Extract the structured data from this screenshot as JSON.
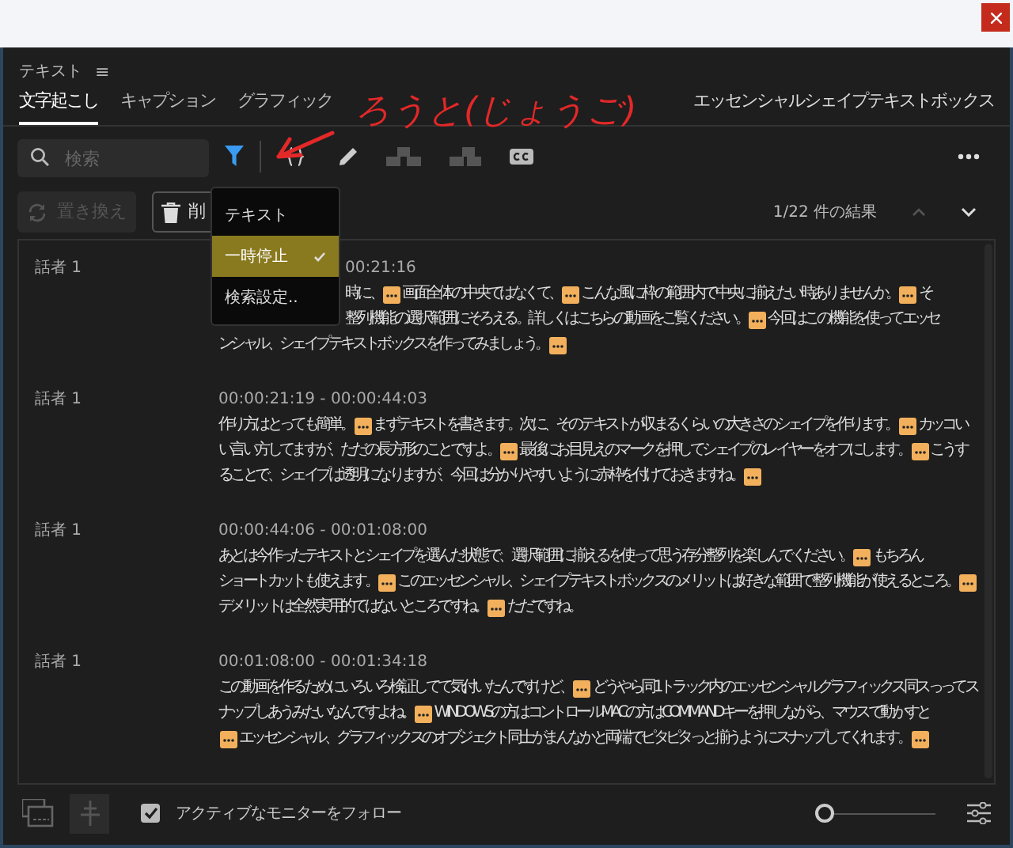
{
  "panel": {
    "title": "テキスト",
    "menu_icon": "≡"
  },
  "tabs": [
    {
      "label": "文字起こし",
      "selected": true
    },
    {
      "label": "キャプション",
      "selected": false
    },
    {
      "label": "グラフィック",
      "selected": false
    }
  ],
  "panel_context": "エッセンシャルシェイプテキストボックス",
  "annotation": {
    "text": "ろうと(じょうご)"
  },
  "search": {
    "placeholder": "検索"
  },
  "filter": {
    "on": true
  },
  "actions": [
    {
      "label": "置き換え",
      "disabled": true,
      "kind": "replace"
    },
    {
      "label": "削",
      "disabled": false,
      "kind": "delete"
    }
  ],
  "results": "1/22 件の結果",
  "filter_menu": [
    {
      "label": "テキスト",
      "selected": false
    },
    {
      "label": "一時停止",
      "selected": true
    },
    {
      "label": "検索設定..",
      "selected": false
    }
  ],
  "segments": [
    {
      "speaker": "話者 1",
      "timecode": "00:21:16",
      "kind": "partial",
      "lines": [
        [
          {
            "kind": "text",
            "text": "時に、"
          },
          {
            "kind": "marker"
          },
          {
            "kind": "text",
            "text": "画面全体の中央ではなくて、"
          },
          {
            "kind": "marker"
          },
          {
            "kind": "text",
            "text": "こんな風に枠の範囲内で中央に揃えたい時ありませんか。"
          },
          {
            "kind": "marker"
          },
          {
            "kind": "text",
            "text": "そ"
          }
        ],
        [
          {
            "kind": "text",
            "text": "整列機能の選択範囲にそろえる。詳しくはこちらの動画をご覧ください。"
          },
          {
            "kind": "marker"
          },
          {
            "kind": "text",
            "text": "今回はこの機能を使ってエッセ"
          }
        ],
        [
          {
            "kind": "text",
            "text": "ンシャル、シェイプテキストボックスを作ってみましょう。"
          },
          {
            "kind": "marker"
          }
        ]
      ]
    },
    {
      "speaker": "話者 1",
      "timecode": "00:00:21:19 - 00:00:44:03",
      "kind": "full",
      "lines": [
        [
          {
            "kind": "text",
            "text": "作り方はとっても簡単。"
          },
          {
            "kind": "marker"
          },
          {
            "kind": "text",
            "text": "まずテキストを書きます。次に、そのテキストが収まるくらいの大きさのシェイプを作ります。"
          },
          {
            "kind": "marker"
          },
          {
            "kind": "text",
            "text": "カッコい"
          }
        ],
        [
          {
            "kind": "text",
            "text": "い言い方してますが、ただの長方形のことですよ。"
          },
          {
            "kind": "marker"
          },
          {
            "kind": "text",
            "text": "最後にお目見えのマークを押してシェイプのレイヤーをオフにします。"
          },
          {
            "kind": "marker"
          },
          {
            "kind": "text",
            "text": "こうす"
          }
        ],
        [
          {
            "kind": "text",
            "text": "ることで、シェイプは透明になりますが、今回は分かりやすいように赤枠を付けておきますね。"
          },
          {
            "kind": "marker"
          }
        ]
      ]
    },
    {
      "speaker": "話者 1",
      "timecode": "00:00:44:06 - 00:01:08:00",
      "kind": "full",
      "lines": [
        [
          {
            "kind": "text",
            "text": "あとは今作ったテキストとシェイプを選んだ状態で、選択範囲に揃えるを使って思う存分整列を楽しんでください。"
          },
          {
            "kind": "marker"
          },
          {
            "kind": "text",
            "text": "もちろん"
          }
        ],
        [
          {
            "kind": "text",
            "text": "ショートカットも使えます。"
          },
          {
            "kind": "marker"
          },
          {
            "kind": "text",
            "text": "このエッセンシャル、シェイプテキストボックスのメリットは好きな範囲で整列機能が使えるところ。"
          },
          {
            "kind": "marker"
          }
        ],
        [
          {
            "kind": "text",
            "text": "デメリットは全然実用的ではないところですね。"
          },
          {
            "kind": "marker"
          },
          {
            "kind": "text",
            "text": "ただですね。"
          }
        ]
      ]
    },
    {
      "speaker": "話者 1",
      "timecode": "00:01:08:00 - 00:01:34:18",
      "kind": "full",
      "lines": [
        [
          {
            "kind": "text",
            "text": "この動画を作るためにいろいろ検証してて気付いたんですけど、"
          },
          {
            "kind": "marker"
          },
          {
            "kind": "text",
            "text": "どうやら同1トラック内のエッセンシャルグラフィックス同スっってス"
          }
        ],
        [
          {
            "kind": "text",
            "text": "ナップしあうみたいなんですよね。"
          },
          {
            "kind": "marker"
          },
          {
            "kind": "text",
            "text": "WINDOWSの方はコントロールMACの方はCOMMANDキーを押しながら、マウスで動かすと"
          }
        ],
        [
          {
            "kind": "marker"
          },
          {
            "kind": "text",
            "text": "エッセンシャル、グラフィックスのオブジェクト同士がまんなかと両端でピタピタっと揃うようにスナップしてくれます。"
          },
          {
            "kind": "marker"
          }
        ]
      ]
    }
  ],
  "footer": {
    "follow_monitor": {
      "label": "アクティブなモニターをフォロー",
      "checked": true
    },
    "zoom": {
      "level": 0
    }
  }
}
